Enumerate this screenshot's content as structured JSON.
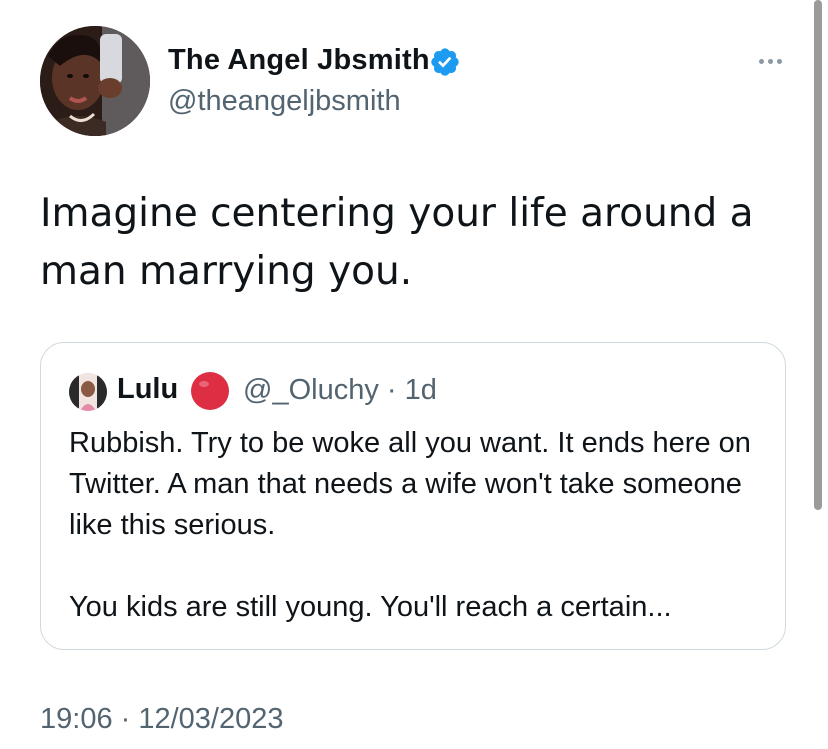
{
  "tweet": {
    "author": {
      "display_name": "The Angel Jbsmith",
      "handle": "@theangeljbsmith",
      "verified": true,
      "avatar_icon": "profile-photo"
    },
    "more_icon": "ellipsis-icon",
    "text": "Imagine centering your life around a man marrying you.",
    "timestamp": "19:06 · 12/03/2023"
  },
  "quote": {
    "author": {
      "display_name": "Lulu",
      "emoji_icon": "red-circle-icon",
      "handle_time": "@_Oluchy · 1d"
    },
    "paragraphs": [
      "Rubbish. Try to be woke all you want. It ends here on Twitter. A man that needs a wife won't take someone like this serious.",
      "You kids are still young. You'll reach a certain..."
    ]
  },
  "colors": {
    "text_primary": "#0f1419",
    "text_secondary": "#536471",
    "verified_blue": "#1d9bf0",
    "card_border": "#cfd9de",
    "emoji_red": "#dd2e44"
  }
}
